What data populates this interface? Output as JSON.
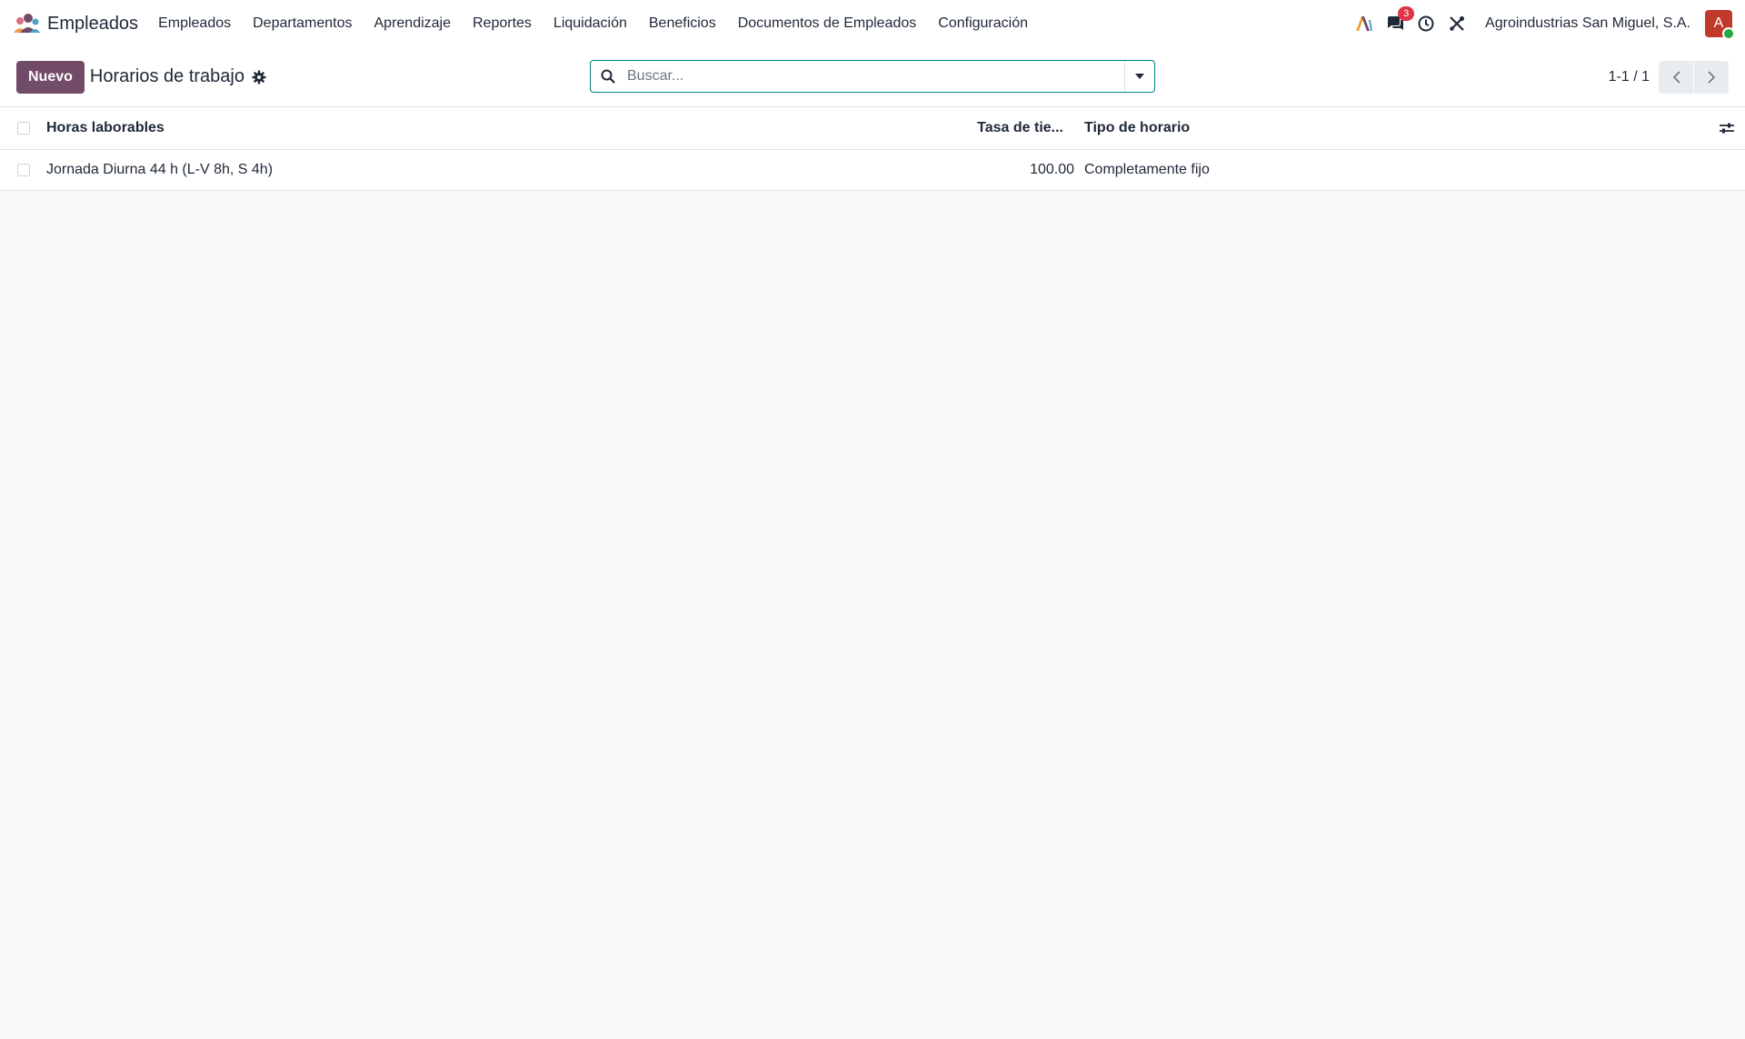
{
  "app": {
    "name": "Empleados",
    "brand_colors": [
      "#f39c4a",
      "#e06b7a",
      "#714b67",
      "#4fa3c7"
    ]
  },
  "menu": {
    "items": [
      {
        "label": "Empleados"
      },
      {
        "label": "Departamentos"
      },
      {
        "label": "Aprendizaje"
      },
      {
        "label": "Reportes"
      },
      {
        "label": "Liquidación"
      },
      {
        "label": "Beneficios"
      },
      {
        "label": "Documentos de Empleados"
      },
      {
        "label": "Configuración"
      }
    ]
  },
  "systray": {
    "ai_icon": "ai-icon",
    "messages_icon": "chat-icon",
    "messages_count": "3",
    "activity_icon": "clock-icon",
    "debug_icon": "tools-icon",
    "company": "Agroindustrias San Miguel, S.A.",
    "avatar_initial": "A",
    "avatar_color": "#c0392b"
  },
  "control": {
    "new_label": "Nuevo",
    "title": "Horarios de trabajo",
    "search_placeholder": "Buscar...",
    "pager": "1-1 / 1",
    "accent": "#714b67",
    "search_border": "#017e84"
  },
  "table": {
    "columns": [
      "Horas laborables",
      "Tasa de tie...",
      "Tipo de horario"
    ],
    "rows": [
      {
        "name": "Jornada Diurna 44 h (L-V 8h, S 4h)",
        "rate": "100.00",
        "type": "Completamente fijo"
      }
    ]
  }
}
